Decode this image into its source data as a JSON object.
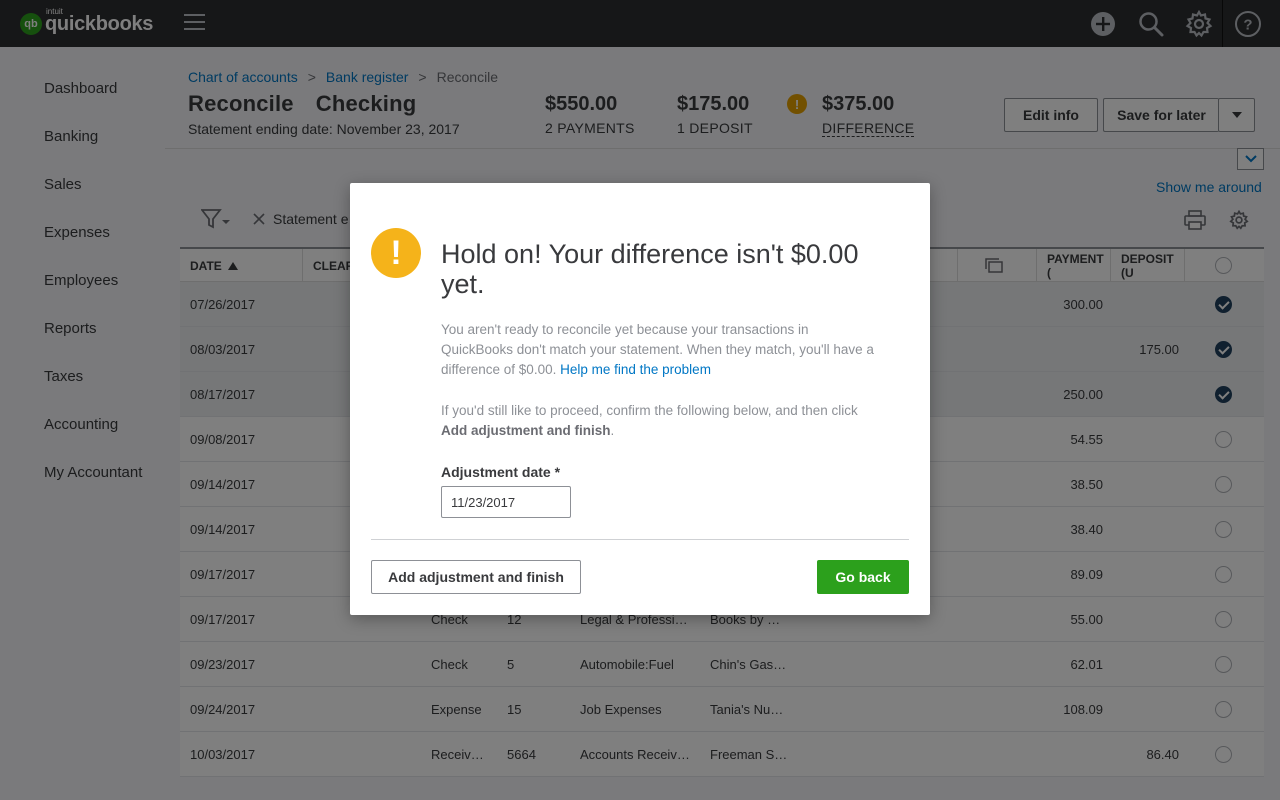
{
  "app": {
    "logo_small": "qb",
    "logo_brand": "intuit",
    "logo_name": "quickbooks"
  },
  "sidebar": {
    "items": [
      {
        "label": "Dashboard"
      },
      {
        "label": "Banking"
      },
      {
        "label": "Sales"
      },
      {
        "label": "Expenses"
      },
      {
        "label": "Employees"
      },
      {
        "label": "Reports"
      },
      {
        "label": "Taxes"
      },
      {
        "label": "Accounting"
      },
      {
        "label": "My Accountant"
      }
    ]
  },
  "breadcrumb": {
    "item1": "Chart of accounts",
    "item2": "Bank register",
    "item3": "Reconcile",
    "sep": ">"
  },
  "header": {
    "title": "Reconcile",
    "account": "Checking",
    "statement_date": "Statement ending date: November 23, 2017",
    "payments_amount": "$550.00",
    "payments_label": "2 PAYMENTS",
    "deposits_amount": "$175.00",
    "deposits_label": "1 DEPOSIT",
    "difference_amount": "$375.00",
    "difference_label": "DIFFERENCE",
    "warn_glyph": "!",
    "edit_info": "Edit info",
    "save_for_later": "Save for later",
    "show_me_around": "Show me around"
  },
  "filter": {
    "chip_label": "Statement e"
  },
  "table": {
    "columns": {
      "date": "DATE",
      "cleared": "CLEAR",
      "payment": "PAYMENT (",
      "deposit": "DEPOSIT (U"
    },
    "rows": [
      {
        "date": "07/26/2017",
        "type": "",
        "ref": "",
        "account": "",
        "payee": "",
        "payment": "300.00",
        "deposit": "",
        "checked": true
      },
      {
        "date": "08/03/2017",
        "type": "",
        "ref": "",
        "account": "",
        "payee": "",
        "payment": "",
        "deposit": "175.00",
        "checked": true
      },
      {
        "date": "08/17/2017",
        "type": "",
        "ref": "",
        "account": "",
        "payee": "",
        "payment": "250.00",
        "deposit": "",
        "checked": true
      },
      {
        "date": "09/08/2017",
        "type": "",
        "ref": "",
        "account": "",
        "payee": "",
        "payment": "54.55",
        "deposit": "",
        "checked": false
      },
      {
        "date": "09/14/2017",
        "type": "",
        "ref": "",
        "account": "",
        "payee": "",
        "payment": "38.50",
        "deposit": "",
        "checked": false
      },
      {
        "date": "09/14/2017",
        "type": "",
        "ref": "",
        "account": "",
        "payee": "",
        "payment": "38.40",
        "deposit": "",
        "checked": false
      },
      {
        "date": "09/17/2017",
        "type": "",
        "ref": "",
        "account": "",
        "payee": "",
        "payment": "89.09",
        "deposit": "",
        "checked": false
      },
      {
        "date": "09/17/2017",
        "type": "Check",
        "ref": "12",
        "account": "Legal & Professi…",
        "payee": "Books by …",
        "payment": "55.00",
        "deposit": "",
        "checked": false
      },
      {
        "date": "09/23/2017",
        "type": "Check",
        "ref": "5",
        "account": "Automobile:Fuel",
        "payee": "Chin's Gas…",
        "payment": "62.01",
        "deposit": "",
        "checked": false
      },
      {
        "date": "09/24/2017",
        "type": "Expense",
        "ref": "15",
        "account": "Job Expenses",
        "payee": "Tania's Nu…",
        "payment": "108.09",
        "deposit": "",
        "checked": false
      },
      {
        "date": "10/03/2017",
        "type": "Receiv…",
        "ref": "5664",
        "account": "Accounts Receiv…",
        "payee": "Freeman S…",
        "payment": "",
        "deposit": "86.40",
        "checked": false
      }
    ]
  },
  "modal": {
    "warn_glyph": "!",
    "title": "Hold on! Your difference isn't $0.00 yet.",
    "para1": "You aren't ready to reconcile yet because your transactions in QuickBooks don't match your statement. When they match, you'll have a difference of $0.00.",
    "help_link": "Help me find the problem",
    "para2_prefix": "If you'd still like to proceed, confirm the following below, and then click",
    "para2_bold": "Add adjustment and finish",
    "para2_suffix": ".",
    "adjustment_label": "Adjustment date *",
    "adjustment_value": "11/23/2017",
    "add_adjustment_button": "Add adjustment and finish",
    "go_back_button": "Go back"
  },
  "colors": {
    "brand_green": "#2ca01c",
    "link_blue": "#0077c5",
    "warn_orange": "#f5b31a",
    "topbar": "#2d2e30"
  }
}
